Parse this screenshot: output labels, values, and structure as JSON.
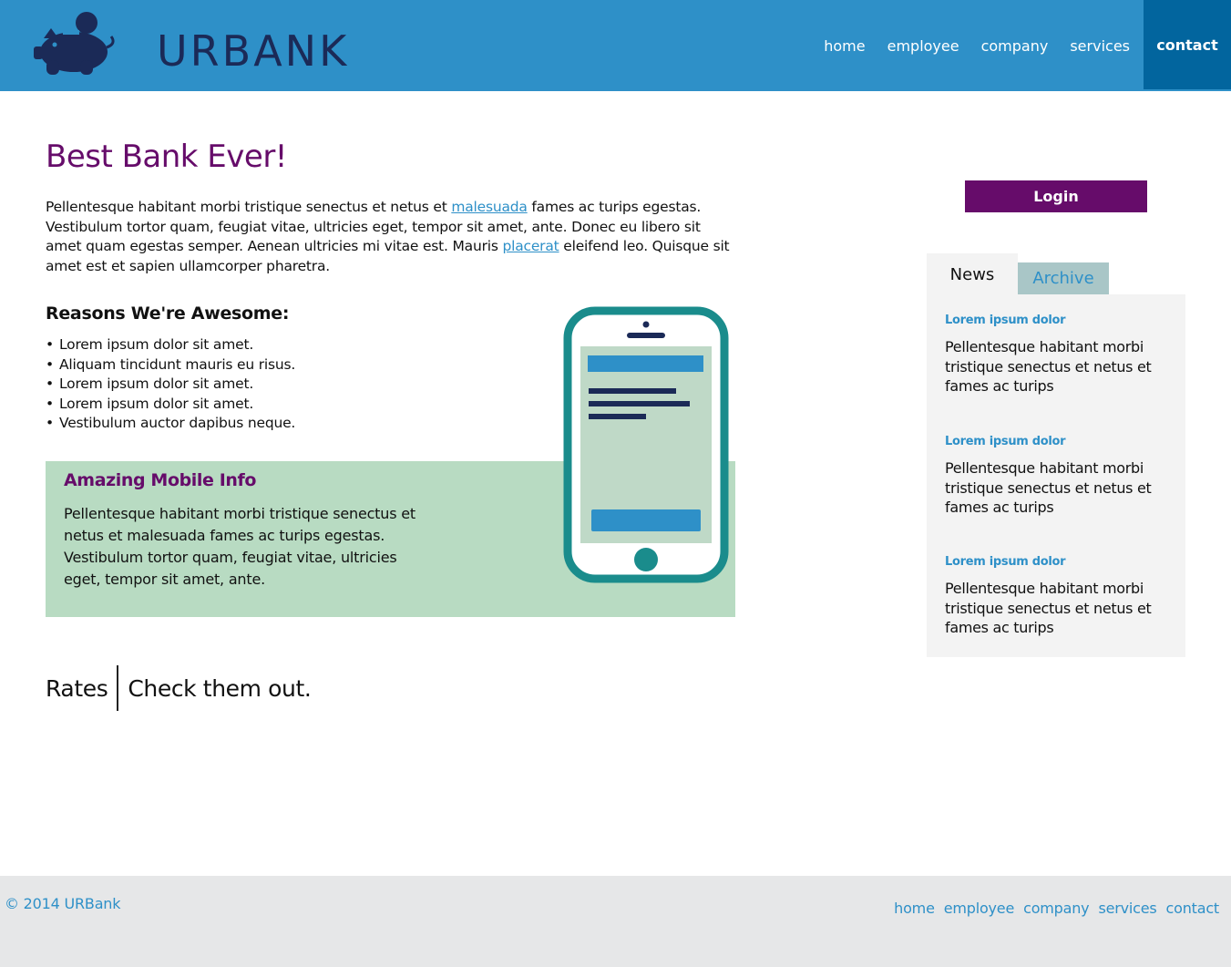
{
  "header": {
    "logo_text": "URBANK",
    "nav": [
      "home",
      "employee",
      "company",
      "services",
      "contact"
    ],
    "active_nav": "contact"
  },
  "main": {
    "title": "Best Bank Ever!",
    "intro": {
      "part1": "Pellentesque habitant morbi tristique senectus et netus et ",
      "link1": "malesuada",
      "part2": " fames ac turips egestas. Vestibulum tortor quam, feugiat vitae, ultricies eget, tempor sit amet, ante. Donec eu libero sit amet quam egestas semper. Aenean ultricies mi vitae est. Mauris ",
      "link2": "placerat",
      "part3": " eleifend leo. Quisque sit amet est et sapien ullamcorper pharetra."
    },
    "reasons_title": "Reasons We're Awesome:",
    "reasons": [
      "Lorem ipsum dolor sit amet.",
      "Aliquam tincidunt mauris eu risus.",
      "Lorem ipsum dolor sit amet.",
      "Lorem ipsum dolor sit amet.",
      "Vestibulum auctor dapibus neque."
    ],
    "mobile": {
      "title": "Amazing Mobile Info",
      "text": "Pellentesque habitant morbi tristique senectus et netus et malesuada fames ac turips egestas. Vestibulum tortor quam, feugiat vitae, ultricies eget, tempor sit amet, ante."
    },
    "rates": {
      "label": "Rates",
      "subtitle": "Check them out."
    }
  },
  "sidebar": {
    "login_label": "Login",
    "tabs": [
      "News",
      "Archive"
    ],
    "active_tab": "News",
    "news": [
      {
        "title": "Lorem ipsum dolor",
        "body": "Pellentesque habitant morbi tristique senectus et netus et fames ac turips"
      },
      {
        "title": "Lorem ipsum dolor",
        "body": "Pellentesque habitant morbi tristique senectus et netus et fames ac turips"
      },
      {
        "title": "Lorem ipsum dolor",
        "body": "Pellentesque habitant morbi tristique senectus et netus et fames ac turips"
      }
    ]
  },
  "footer": {
    "copyright": "© 2014 URBank",
    "nav": [
      "home",
      "employee",
      "company",
      "services",
      "contact"
    ]
  },
  "colors": {
    "header_bg": "#2e90c8",
    "nav_active_bg": "#02659e",
    "brand_purple": "#660c6a",
    "logo_navy": "#1b2a57",
    "mobile_box_bg": "#b8dbc2",
    "phone_teal": "#1a8c8c",
    "footer_bg": "#e6e7e8",
    "sidebar_bg": "#f3f3f3",
    "archive_tab_bg": "#a9c6c7"
  },
  "icons": [
    "piggy-bank-logo-icon",
    "smartphone-illustration-icon"
  ]
}
